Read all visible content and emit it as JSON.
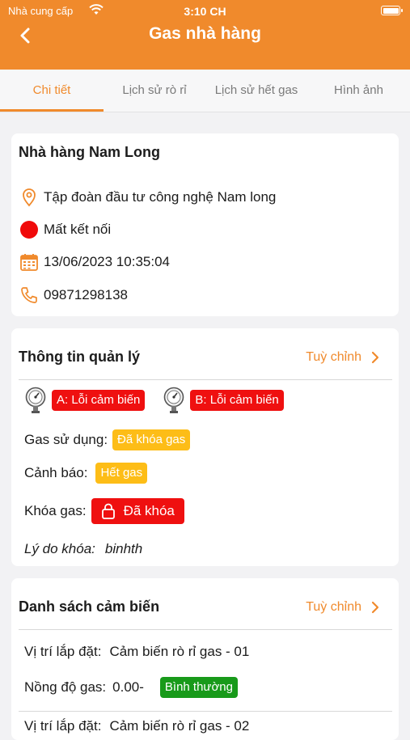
{
  "status_bar": {
    "carrier": "Nhà cung cấp",
    "time": "3:10 CH"
  },
  "header": {
    "title": "Gas nhà hàng"
  },
  "tabs": [
    {
      "label": "Chi tiết",
      "active": true
    },
    {
      "label": "Lịch sử rò rỉ",
      "active": false
    },
    {
      "label": "Lịch sử hết gas",
      "active": false
    },
    {
      "label": "Hình ảnh",
      "active": false
    }
  ],
  "info": {
    "name": "Nhà hàng Nam Long",
    "address": "Tập đoàn đầu tư công nghệ Nam long",
    "connection": "Mất kết nối",
    "datetime": "13/06/2023 10:35:04",
    "phone": "09871298138"
  },
  "management": {
    "title": "Thông tin quản lý",
    "customize": "Tuỳ chỉnh",
    "sensor_a": "A: Lỗi cảm biến",
    "sensor_b": "B: Lỗi cảm biến",
    "gas_usage_label": "Gas sử dụng:",
    "gas_usage_value": "Đã khóa gas",
    "warning_label": "Cảnh báo:",
    "warning_value": "Hết gas",
    "lock_label": "Khóa gas:",
    "lock_value": "Đã khóa",
    "reason_label": "Lý do khóa:",
    "reason_value": "binhth"
  },
  "sensors": {
    "title": "Danh sách cảm biến",
    "customize": "Tuỳ chỉnh",
    "items": [
      {
        "location_label": "Vị trí lắp đặt:",
        "location": "Cảm biến rò rỉ gas - 01",
        "concentration_label": "Nồng độ gas:",
        "concentration": "0.00-",
        "status": "Bình thường"
      },
      {
        "location_label": "Vị trí lắp đặt:",
        "location": "Cảm biến rò rỉ gas - 02"
      }
    ]
  },
  "colors": {
    "accent": "#f08a2c",
    "danger": "#ef1010",
    "warning": "#fdbd17",
    "ok": "#189a1a"
  },
  "icons": [
    "back-arrow-icon",
    "wifi-icon",
    "battery-icon",
    "location-pin-icon",
    "status-dot-icon",
    "calendar-icon",
    "phone-icon",
    "chevron-right-icon",
    "pressure-gauge-icon",
    "lock-icon"
  ]
}
